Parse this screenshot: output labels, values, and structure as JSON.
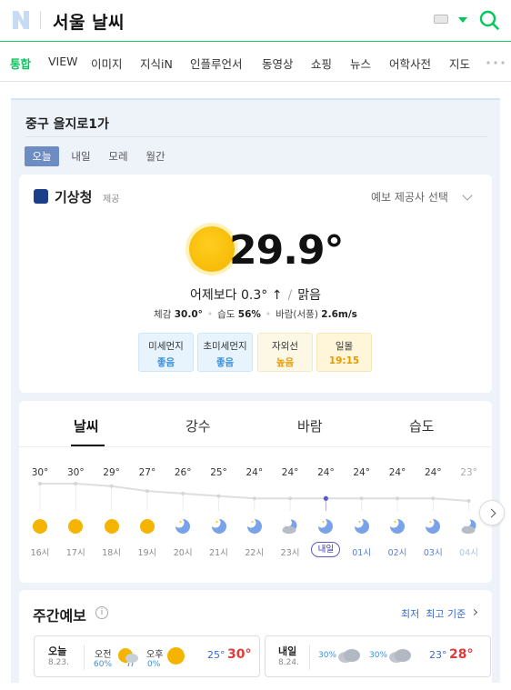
{
  "header": {
    "query": "서울 날씨"
  },
  "tabs": [
    "통합",
    "VIEW",
    "이미지",
    "지식iN",
    "인플루언서",
    "동영상",
    "쇼핑",
    "뉴스",
    "어학사전",
    "지도"
  ],
  "location": "중구 을지로1가",
  "day_tabs": [
    "오늘",
    "내일",
    "모레",
    "월간"
  ],
  "provider": {
    "name": "기상청",
    "sub": "제공",
    "select": "예보 제공사 선택"
  },
  "current": {
    "temp": "29.9°",
    "compare": "어제보다 0.3° ↑",
    "condition": "맑음",
    "feel_label": "체감",
    "feel": "30.0°",
    "humid_label": "습도",
    "humid": "56%",
    "wind_label": "바람(서풍)",
    "wind": "2.6m/s"
  },
  "air": [
    {
      "label": "미세먼지",
      "value": "좋음"
    },
    {
      "label": "초미세먼지",
      "value": "좋음"
    },
    {
      "label": "자외선",
      "value": "높음"
    },
    {
      "label": "일몰",
      "value": "19:15"
    }
  ],
  "weather_tabs": [
    "날씨",
    "강수",
    "바람",
    "습도"
  ],
  "hourly": [
    {
      "temp": "30°",
      "time": "16시",
      "icon": "sun-icon"
    },
    {
      "temp": "30°",
      "time": "17시",
      "icon": "sun-icon"
    },
    {
      "temp": "29°",
      "time": "18시",
      "icon": "sun-icon"
    },
    {
      "temp": "27°",
      "time": "19시",
      "icon": "sun-icon"
    },
    {
      "temp": "26°",
      "time": "20시",
      "icon": "moon-icon"
    },
    {
      "temp": "25°",
      "time": "21시",
      "icon": "moon-icon"
    },
    {
      "temp": "24°",
      "time": "22시",
      "icon": "moon-icon"
    },
    {
      "temp": "24°",
      "time": "23시",
      "icon": "moon-cloud-icon"
    },
    {
      "temp": "24°",
      "time": "내일",
      "icon": "moon-icon"
    },
    {
      "temp": "24°",
      "time": "01시",
      "icon": "moon-icon"
    },
    {
      "temp": "24°",
      "time": "02시",
      "icon": "moon-icon"
    },
    {
      "temp": "24°",
      "time": "03시",
      "icon": "moon-icon"
    },
    {
      "temp": "23°",
      "time": "04시",
      "icon": "moon-cloud-icon"
    }
  ],
  "hourly_values": [
    30,
    30,
    29,
    27,
    26,
    25,
    24,
    24,
    24,
    24,
    24,
    24,
    23
  ],
  "weekly": {
    "title": "주간예보",
    "basis_low": "최저",
    "basis_text": "최고 기준",
    "days": [
      {
        "name": "오늘",
        "date": "8.23.",
        "am_label": "오전",
        "am_pct": "60%",
        "pm_label": "오후",
        "pm_pct": "0%",
        "low": "25°",
        "high": "30°"
      },
      {
        "name": "내일",
        "date": "8.24.",
        "am_pct": "30%",
        "pm_pct": "30%",
        "low": "23°",
        "high": "28°"
      }
    ]
  }
}
